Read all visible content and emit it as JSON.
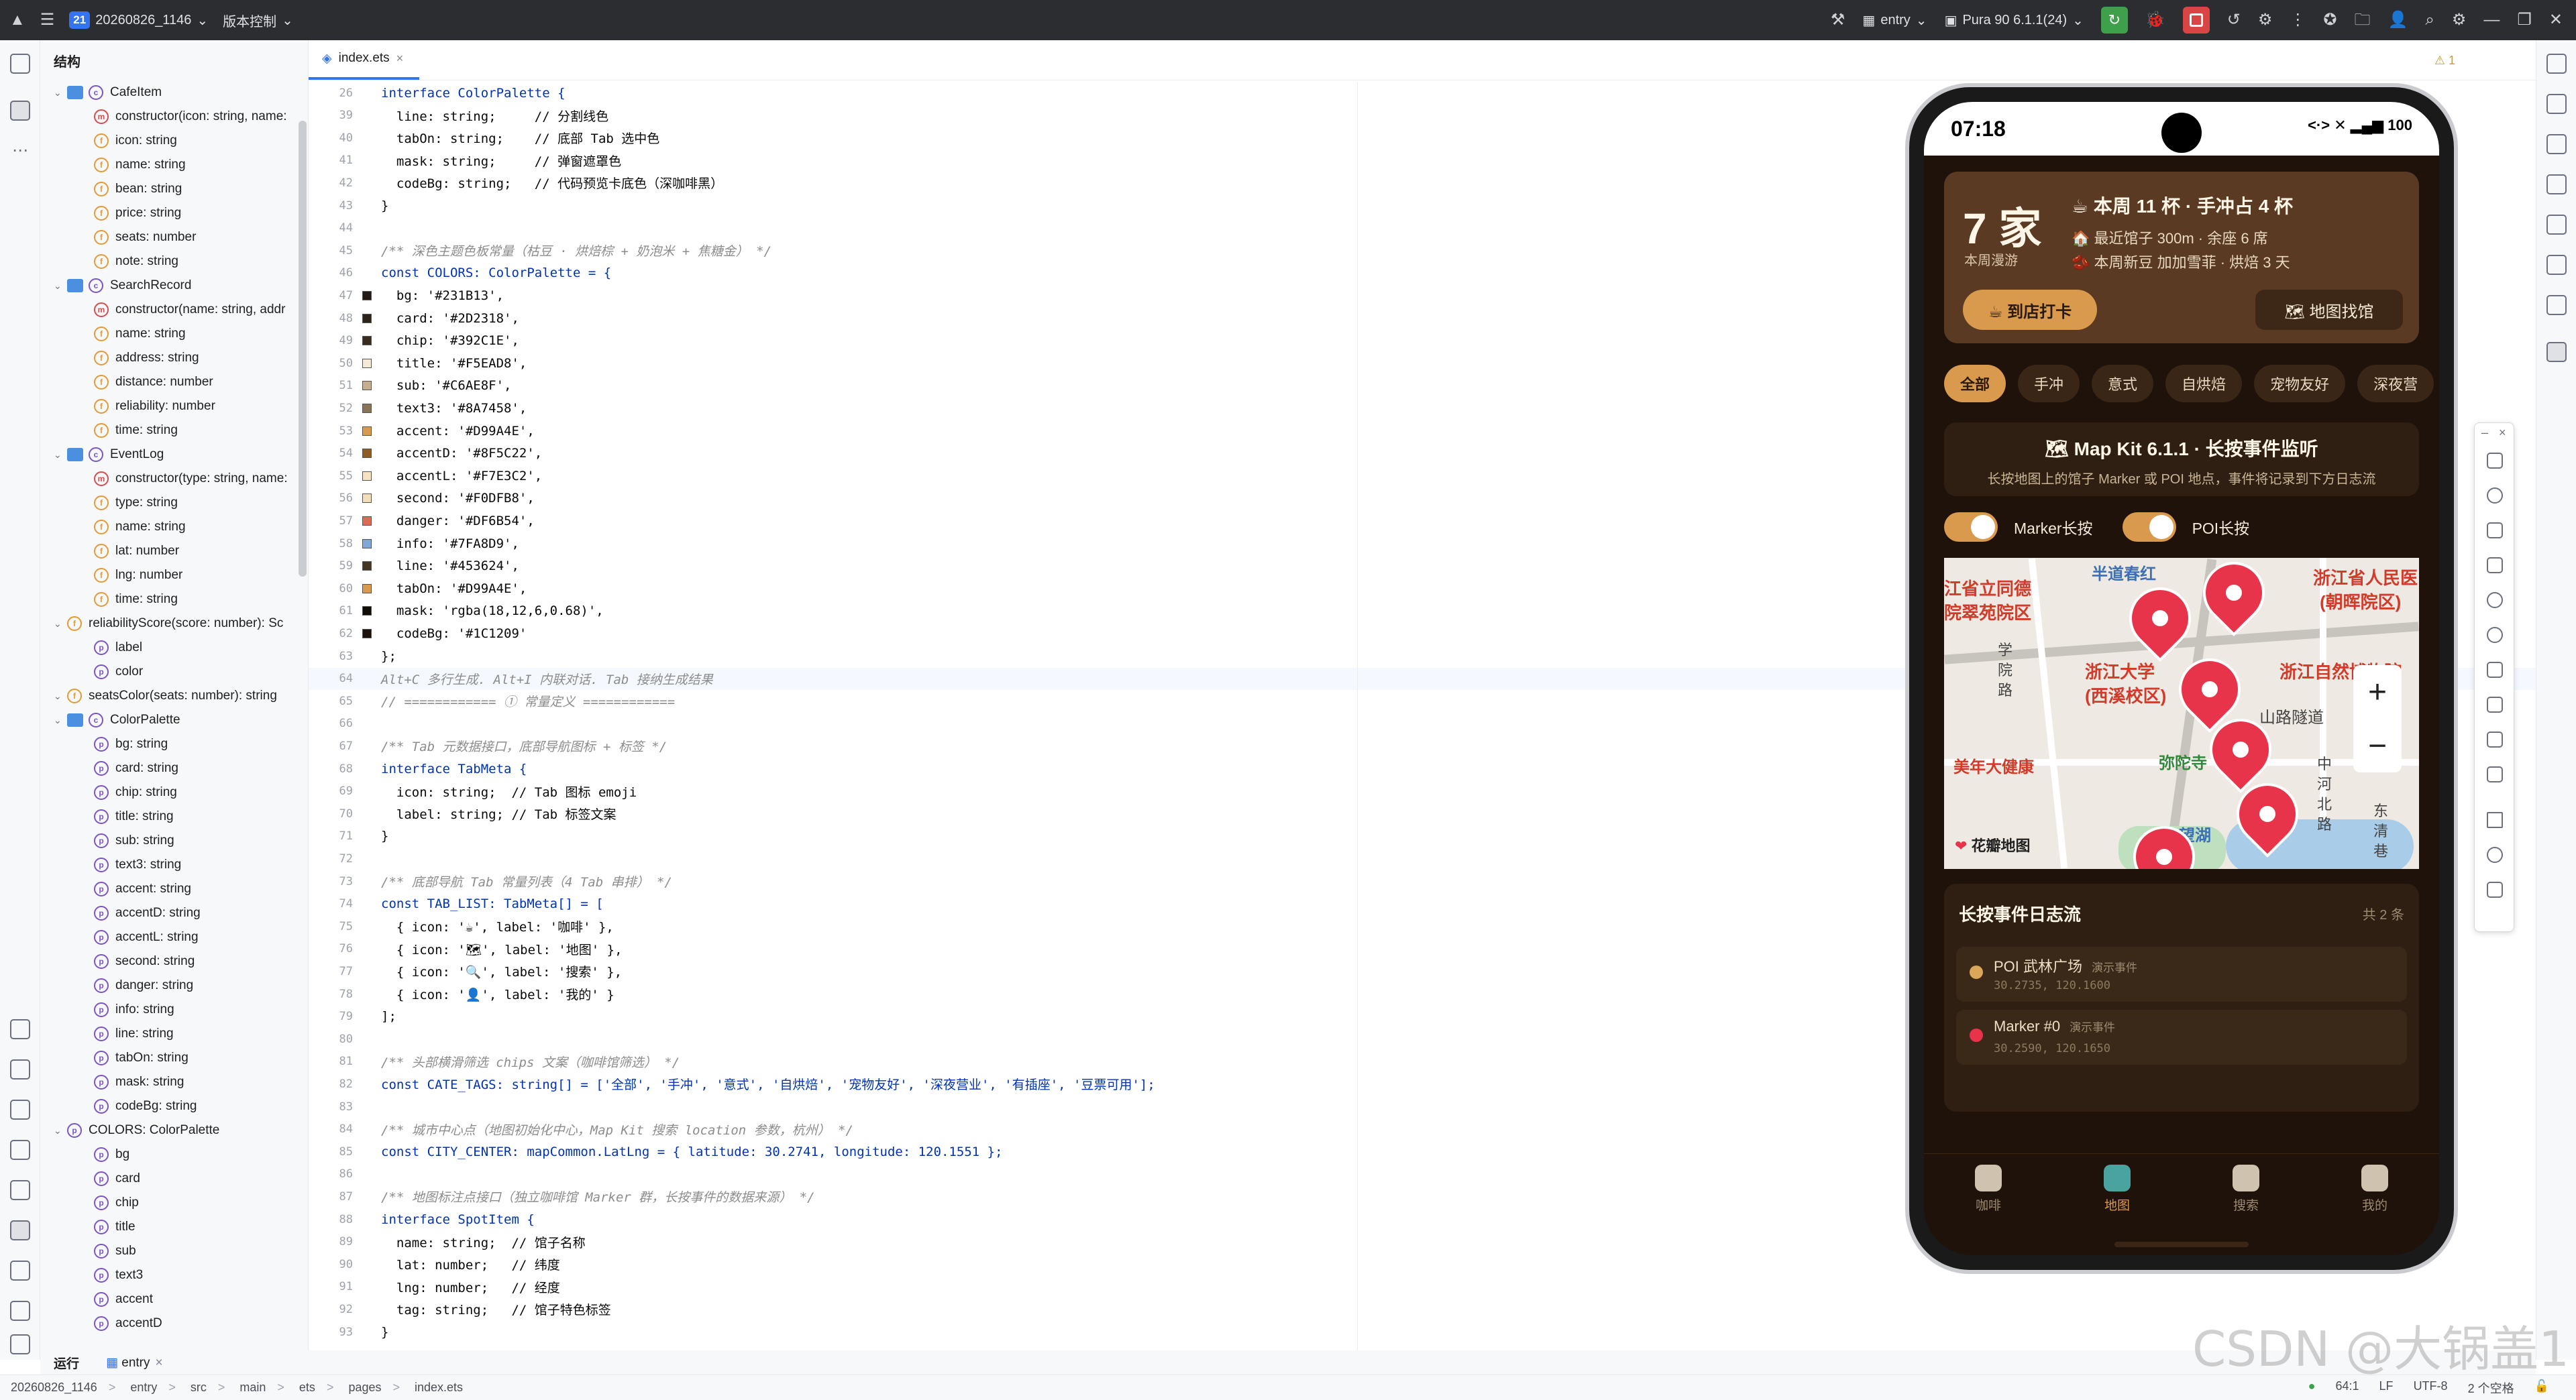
{
  "titlebar": {
    "project_number": "21",
    "project_name": "20260826_1146",
    "vcs_label": "版本控制",
    "run_config": "entry",
    "device": "Pura 90 6.1.1(24)"
  },
  "structure": {
    "title": "结构",
    "rows": [
      {
        "depth": 0,
        "kind": "cls",
        "label": "CafeItem"
      },
      {
        "depth": 1,
        "kind": "m",
        "label": "constructor(icon: string, name:"
      },
      {
        "depth": 1,
        "kind": "f",
        "label": "icon: string"
      },
      {
        "depth": 1,
        "kind": "f",
        "label": "name: string"
      },
      {
        "depth": 1,
        "kind": "f",
        "label": "bean: string"
      },
      {
        "depth": 1,
        "kind": "f",
        "label": "price: string"
      },
      {
        "depth": 1,
        "kind": "f",
        "label": "seats: number"
      },
      {
        "depth": 1,
        "kind": "f",
        "label": "note: string"
      },
      {
        "depth": 0,
        "kind": "cls",
        "label": "SearchRecord"
      },
      {
        "depth": 1,
        "kind": "m",
        "label": "constructor(name: string, addr"
      },
      {
        "depth": 1,
        "kind": "f",
        "label": "name: string"
      },
      {
        "depth": 1,
        "kind": "f",
        "label": "address: string"
      },
      {
        "depth": 1,
        "kind": "f",
        "label": "distance: number"
      },
      {
        "depth": 1,
        "kind": "f",
        "label": "reliability: number"
      },
      {
        "depth": 1,
        "kind": "f",
        "label": "time: string"
      },
      {
        "depth": 0,
        "kind": "cls",
        "label": "EventLog"
      },
      {
        "depth": 1,
        "kind": "m",
        "label": "constructor(type: string, name:"
      },
      {
        "depth": 1,
        "kind": "f",
        "label": "type: string"
      },
      {
        "depth": 1,
        "kind": "f",
        "label": "name: string"
      },
      {
        "depth": 1,
        "kind": "f",
        "label": "lat: number"
      },
      {
        "depth": 1,
        "kind": "f",
        "label": "lng: number"
      },
      {
        "depth": 1,
        "kind": "f",
        "label": "time: string"
      },
      {
        "depth": 0,
        "kind": "f",
        "label": "reliabilityScore(score: number): Sc"
      },
      {
        "depth": 1,
        "kind": "p",
        "label": "label"
      },
      {
        "depth": 1,
        "kind": "p",
        "label": "color"
      },
      {
        "depth": 0,
        "kind": "f",
        "label": "seatsColor(seats: number): string"
      },
      {
        "depth": 0,
        "kind": "cls",
        "label": "ColorPalette"
      },
      {
        "depth": 1,
        "kind": "p",
        "label": "bg: string"
      },
      {
        "depth": 1,
        "kind": "p",
        "label": "card: string"
      },
      {
        "depth": 1,
        "kind": "p",
        "label": "chip: string"
      },
      {
        "depth": 1,
        "kind": "p",
        "label": "title: string"
      },
      {
        "depth": 1,
        "kind": "p",
        "label": "sub: string"
      },
      {
        "depth": 1,
        "kind": "p",
        "label": "text3: string"
      },
      {
        "depth": 1,
        "kind": "p",
        "label": "accent: string"
      },
      {
        "depth": 1,
        "kind": "p",
        "label": "accentD: string"
      },
      {
        "depth": 1,
        "kind": "p",
        "label": "accentL: string"
      },
      {
        "depth": 1,
        "kind": "p",
        "label": "second: string"
      },
      {
        "depth": 1,
        "kind": "p",
        "label": "danger: string"
      },
      {
        "depth": 1,
        "kind": "p",
        "label": "info: string"
      },
      {
        "depth": 1,
        "kind": "p",
        "label": "line: string"
      },
      {
        "depth": 1,
        "kind": "p",
        "label": "tabOn: string"
      },
      {
        "depth": 1,
        "kind": "p",
        "label": "mask: string"
      },
      {
        "depth": 1,
        "kind": "p",
        "label": "codeBg: string"
      },
      {
        "depth": 0,
        "kind": "c",
        "label": "COLORS: ColorPalette"
      },
      {
        "depth": 1,
        "kind": "p",
        "label": "bg"
      },
      {
        "depth": 1,
        "kind": "p",
        "label": "card"
      },
      {
        "depth": 1,
        "kind": "p",
        "label": "chip"
      },
      {
        "depth": 1,
        "kind": "p",
        "label": "title"
      },
      {
        "depth": 1,
        "kind": "p",
        "label": "sub"
      },
      {
        "depth": 1,
        "kind": "p",
        "label": "text3"
      },
      {
        "depth": 1,
        "kind": "p",
        "label": "accent"
      },
      {
        "depth": 1,
        "kind": "p",
        "label": "accentD"
      }
    ]
  },
  "editor": {
    "tab_label": "index.ets",
    "warnings": "⚠ 1",
    "lines": [
      {
        "n": "26",
        "text": "interface ColorPalette {",
        "cls": "kw"
      },
      {
        "n": "39",
        "text": "  line: string;     // 分割线色",
        "cls": ""
      },
      {
        "n": "40",
        "text": "  tabOn: string;    // 底部 Tab 选中色",
        "cls": ""
      },
      {
        "n": "41",
        "text": "  mask: string;     // 弹窗遮罩色",
        "cls": ""
      },
      {
        "n": "42",
        "text": "  codeBg: string;   // 代码预览卡底色（深咖啡黑）",
        "cls": ""
      },
      {
        "n": "43",
        "text": "}",
        "cls": ""
      },
      {
        "n": "44",
        "text": "",
        "cls": ""
      },
      {
        "n": "45",
        "text": "/** 深色主题色板常量（枯豆 · 烘焙棕 + 奶泡米 + 焦糖金） */",
        "cls": "cm"
      },
      {
        "n": "46",
        "text": "const COLORS: ColorPalette = {",
        "cls": "kw"
      },
      {
        "n": "47",
        "text": "  bg: '#231B13',",
        "cls": "",
        "sw": "#231B13"
      },
      {
        "n": "48",
        "text": "  card: '#2D2318',",
        "cls": "",
        "sw": "#2D2318"
      },
      {
        "n": "49",
        "text": "  chip: '#392C1E',",
        "cls": "",
        "sw": "#392C1E"
      },
      {
        "n": "50",
        "text": "  title: '#F5EAD8',",
        "cls": "",
        "sw": "#F5EAD8"
      },
      {
        "n": "51",
        "text": "  sub: '#C6AE8F',",
        "cls": "",
        "sw": "#C6AE8F"
      },
      {
        "n": "52",
        "text": "  text3: '#8A7458',",
        "cls": "",
        "sw": "#8A7458"
      },
      {
        "n": "53",
        "text": "  accent: '#D99A4E',",
        "cls": "",
        "sw": "#D99A4E"
      },
      {
        "n": "54",
        "text": "  accentD: '#8F5C22',",
        "cls": "",
        "sw": "#8F5C22"
      },
      {
        "n": "55",
        "text": "  accentL: '#F7E3C2',",
        "cls": "",
        "sw": "#F7E3C2"
      },
      {
        "n": "56",
        "text": "  second: '#F0DFB8',",
        "cls": "",
        "sw": "#F0DFB8"
      },
      {
        "n": "57",
        "text": "  danger: '#DF6B54',",
        "cls": "",
        "sw": "#DF6B54"
      },
      {
        "n": "58",
        "text": "  info: '#7FA8D9',",
        "cls": "",
        "sw": "#7FA8D9"
      },
      {
        "n": "59",
        "text": "  line: '#453624',",
        "cls": "",
        "sw": "#453624"
      },
      {
        "n": "60",
        "text": "  tabOn: '#D99A4E',",
        "cls": "",
        "sw": "#D99A4E"
      },
      {
        "n": "61",
        "text": "  mask: 'rgba(18,12,6,0.68)',",
        "cls": "",
        "sw": "#120C06"
      },
      {
        "n": "62",
        "text": "  codeBg: '#1C1209'",
        "cls": "",
        "sw": "#1C1209"
      },
      {
        "n": "63",
        "text": "};",
        "cls": ""
      },
      {
        "n": "64",
        "text": "Alt+C 多行生成. Alt+I 内联对话. Tab 接纳生成结果",
        "cls": "cm",
        "cur": true
      },
      {
        "n": "65",
        "text": "// ============ ① 常量定义 ============",
        "cls": "cm"
      },
      {
        "n": "66",
        "text": "",
        "cls": ""
      },
      {
        "n": "67",
        "text": "/** Tab 元数据接口，底部导航图标 + 标签 */",
        "cls": "cm"
      },
      {
        "n": "68",
        "text": "interface TabMeta {",
        "cls": "kw"
      },
      {
        "n": "69",
        "text": "  icon: string;  // Tab 图标 emoji",
        "cls": ""
      },
      {
        "n": "70",
        "text": "  label: string; // Tab 标签文案",
        "cls": ""
      },
      {
        "n": "71",
        "text": "}",
        "cls": ""
      },
      {
        "n": "72",
        "text": "",
        "cls": ""
      },
      {
        "n": "73",
        "text": "/** 底部导航 Tab 常量列表（4 Tab 串排） */",
        "cls": "cm"
      },
      {
        "n": "74",
        "text": "const TAB_LIST: TabMeta[] = [",
        "cls": "kw"
      },
      {
        "n": "75",
        "text": "  { icon: '☕', label: '咖啡' },",
        "cls": ""
      },
      {
        "n": "76",
        "text": "  { icon: '🗺', label: '地图' },",
        "cls": ""
      },
      {
        "n": "77",
        "text": "  { icon: '🔍', label: '搜索' },",
        "cls": ""
      },
      {
        "n": "78",
        "text": "  { icon: '👤', label: '我的' }",
        "cls": ""
      },
      {
        "n": "79",
        "text": "];",
        "cls": ""
      },
      {
        "n": "80",
        "text": "",
        "cls": ""
      },
      {
        "n": "81",
        "text": "/** 头部横滑筛选 chips 文案（咖啡馆筛选） */",
        "cls": "cm"
      },
      {
        "n": "82",
        "text": "const CATE_TAGS: string[] = ['全部', '手冲', '意式', '自烘焙', '宠物友好', '深夜营业', '有插座', '豆票可用'];",
        "cls": "kw"
      },
      {
        "n": "83",
        "text": "",
        "cls": ""
      },
      {
        "n": "84",
        "text": "/** 城市中心点（地图初始化中心，Map Kit 搜索 location 参数，杭州） */",
        "cls": "cm"
      },
      {
        "n": "85",
        "text": "const CITY_CENTER: mapCommon.LatLng = { latitude: 30.2741, longitude: 120.1551 };",
        "cls": "kw"
      },
      {
        "n": "86",
        "text": "",
        "cls": ""
      },
      {
        "n": "87",
        "text": "/** 地图标注点接口（独立咖啡馆 Marker 群，长按事件的数据来源） */",
        "cls": "cm"
      },
      {
        "n": "88",
        "text": "interface SpotItem {",
        "cls": "kw"
      },
      {
        "n": "89",
        "text": "  name: string;  // 馆子名称",
        "cls": ""
      },
      {
        "n": "90",
        "text": "  lat: number;   // 纬度",
        "cls": ""
      },
      {
        "n": "91",
        "text": "  lng: number;   // 经度",
        "cls": ""
      },
      {
        "n": "92",
        "text": "  tag: string;   // 馆子特色标签",
        "cls": ""
      },
      {
        "n": "93",
        "text": "}",
        "cls": ""
      }
    ]
  },
  "phone": {
    "time": "07:18",
    "status_right": "<·> ✕ ▂▄▆ 100",
    "hero": {
      "count": "7 家",
      "count_sub": "本周漫游",
      "title": "☕ 本周 11 杯 · 手冲占 4 杯",
      "line1": "🏠 最近馆子 300m · 余座 6 席",
      "line2": "🫘 本周新豆 加加雪菲 · 烘焙 3 天",
      "checkin": "☕ 到店打卡",
      "map_find": "🗺 地图找馆"
    },
    "chips": [
      "全部",
      "手冲",
      "意式",
      "自烘焙",
      "宠物友好",
      "深夜营"
    ],
    "mapkit": {
      "title": "🗺 Map Kit 6.1.1 · 长按事件监听",
      "subtitle": "长按地图上的馆子 Marker 或 POI 地点，事件将记录到下方日志流"
    },
    "toggles": {
      "marker": "Marker长按",
      "poi": "POI长按"
    },
    "map_labels": {
      "a": "半道春红",
      "b": "浙江省人民医",
      "b2": "(朝晖院区)",
      "c": "江省立同德",
      "c2": "院翠苑院区",
      "d": "浙江自然博物院",
      "e": "浙江大学",
      "e2": "(西溪校区)",
      "f": "山路隧道",
      "g": "弥陀寺",
      "h": "美年大健康",
      "i": "望湖",
      "j": "学",
      "j2": "院",
      "j3": "路",
      "k": "中",
      "k2": "河",
      "k3": "北",
      "k4": "路",
      "l": "东",
      "l2": "清",
      "l3": "巷",
      "logo": "花瓣地图"
    },
    "log": {
      "title": "长按事件日志流",
      "count": "共 2 条",
      "items": [
        {
          "type": "POI",
          "name": "武林广场",
          "tag": "演示事件",
          "coord": "30.2735, 120.1600",
          "color": "#d9a65a"
        },
        {
          "type": "Marker",
          "name": "#0",
          "tag": "演示事件",
          "coord": "30.2590, 120.1650",
          "color": "#e8344a"
        }
      ]
    },
    "tabs": [
      "咖啡",
      "地图",
      "搜索",
      "我的"
    ]
  },
  "runbar": {
    "run": "运行",
    "entry": "entry"
  },
  "statusbar": {
    "crumbs": [
      "20260826_1146",
      "entry",
      "src",
      "main",
      "ets",
      "pages",
      "index.ets"
    ],
    "position": "64:1",
    "line_sep": "LF",
    "encoding": "UTF-8",
    "indent": "2 个空格"
  },
  "watermark": "CSDN @大锅盖1"
}
